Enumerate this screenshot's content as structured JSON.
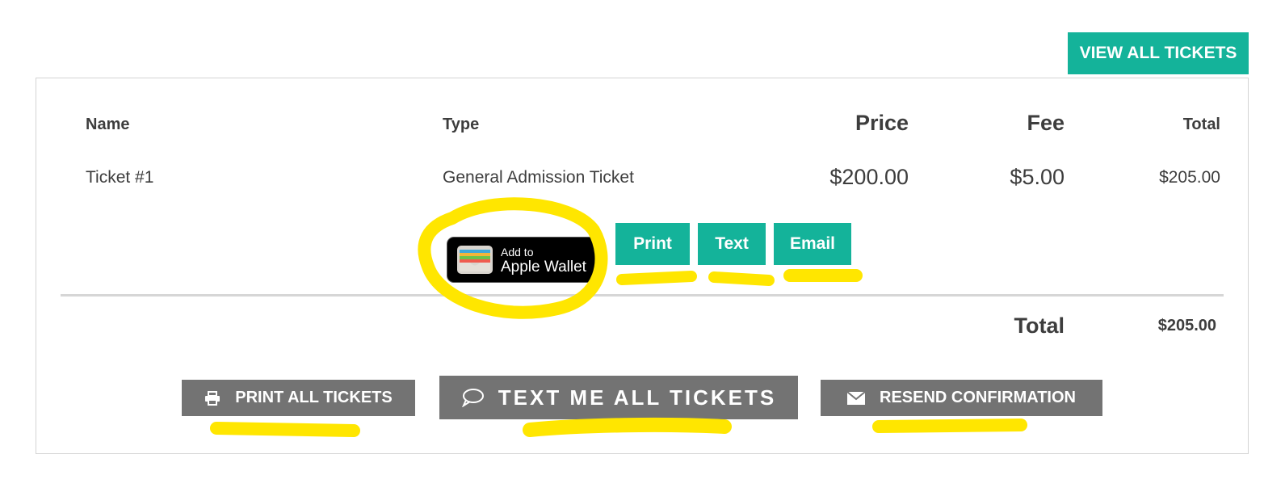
{
  "header": {
    "view_all_label": "VIEW ALL TICKETS"
  },
  "table": {
    "columns": {
      "name": "Name",
      "type": "Type",
      "price": "Price",
      "fee": "Fee",
      "total": "Total"
    },
    "rows": [
      {
        "name": "Ticket #1",
        "type": "General Admission Ticket",
        "price": "$200.00",
        "fee": "$5.00",
        "total": "$205.00"
      }
    ]
  },
  "ticket_actions": {
    "wallet_line1": "Add to",
    "wallet_line2": "Apple Wallet",
    "print_label": "Print",
    "text_label": "Text",
    "email_label": "Email"
  },
  "summary": {
    "total_label": "Total",
    "total_value": "$205.00"
  },
  "footer_actions": {
    "print_all_label": "PRINT ALL TICKETS",
    "text_all_label": "TEXT ME ALL TICKETS",
    "resend_label": "RESEND CONFIRMATION"
  },
  "icons": {
    "printer": "printer-icon",
    "chat": "chat-bubble-icon",
    "envelope": "envelope-icon",
    "wallet": "wallet-icon"
  },
  "colors": {
    "accent": "#14b39a",
    "secondary_button": "#737373",
    "highlight": "#ffe600"
  }
}
